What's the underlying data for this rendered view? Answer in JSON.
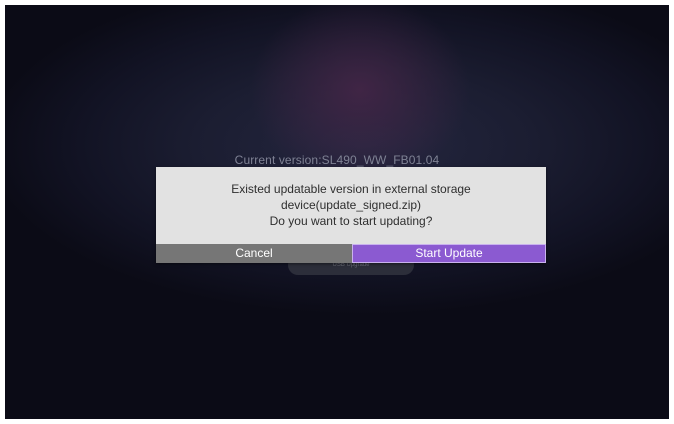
{
  "background": {
    "current_version": "Current version:SL490_WW_FB01.04",
    "usb_update_label": "USB Upgrade"
  },
  "dialog": {
    "message_lines": [
      "Existed updatable version in external storage",
      "device(update_signed.zip)",
      "Do you want to start updating?"
    ],
    "cancel_label": "Cancel",
    "start_label": "Start Update"
  },
  "colors": {
    "accent": "#8b5ad1",
    "cancel_bg": "#767676",
    "dialog_bg": "#e2e2e2"
  }
}
